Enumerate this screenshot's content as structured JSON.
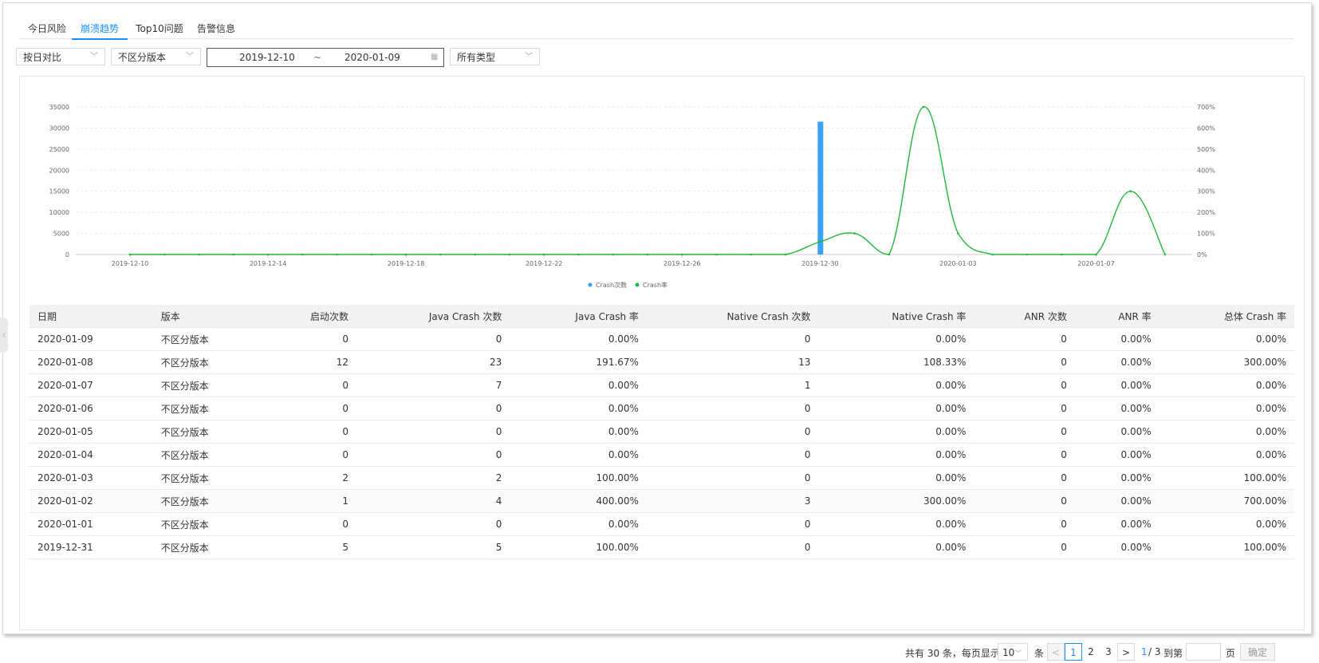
{
  "tabs": [
    {
      "label": "今日风险"
    },
    {
      "label": "崩溃趋势",
      "active": true
    },
    {
      "label": "Top10问题"
    },
    {
      "label": "告警信息"
    }
  ],
  "filters": {
    "compare": "按日对比",
    "version": "不区分版本",
    "date_start": "2019-12-10",
    "date_sep": "~",
    "date_end": "2020-01-09",
    "type": "所有类型"
  },
  "chart_data": {
    "type": "bar",
    "x": [
      "2019-12-10",
      "2019-12-11",
      "2019-12-12",
      "2019-12-13",
      "2019-12-14",
      "2019-12-15",
      "2019-12-16",
      "2019-12-17",
      "2019-12-18",
      "2019-12-19",
      "2019-12-20",
      "2019-12-21",
      "2019-12-22",
      "2019-12-23",
      "2019-12-24",
      "2019-12-25",
      "2019-12-26",
      "2019-12-27",
      "2019-12-28",
      "2019-12-29",
      "2019-12-30",
      "2019-12-31",
      "2020-01-01",
      "2020-01-02",
      "2020-01-03",
      "2020-01-04",
      "2020-01-05",
      "2020-01-06",
      "2020-01-07",
      "2020-01-08",
      "2020-01-09"
    ],
    "x_tick_labels": [
      "2019-12-10",
      "2019-12-14",
      "2019-12-18",
      "2019-12-22",
      "2019-12-26",
      "2019-12-30",
      "2020-01-03",
      "2020-01-07"
    ],
    "series": [
      {
        "name": "Crash次数",
        "type": "bar",
        "axis": "left",
        "color": "#3ba1f5",
        "values": [
          0,
          0,
          0,
          0,
          0,
          0,
          0,
          0,
          0,
          0,
          0,
          0,
          0,
          0,
          0,
          0,
          0,
          0,
          0,
          0,
          31500,
          0,
          0,
          0,
          0,
          0,
          0,
          0,
          0,
          0,
          0
        ]
      },
      {
        "name": "Crash率",
        "type": "line",
        "axis": "right",
        "color": "#20b83a",
        "values": [
          0,
          0,
          0,
          0,
          0,
          0,
          0,
          0,
          0,
          0,
          0,
          0,
          0,
          0,
          0,
          0,
          0,
          0,
          0,
          0,
          60,
          100,
          0,
          700,
          100,
          0,
          0,
          0,
          0,
          300,
          0
        ]
      }
    ],
    "y_left": {
      "ticks": [
        "0",
        "5000",
        "10000",
        "15000",
        "20000",
        "25000",
        "30000",
        "35000"
      ],
      "range": [
        0,
        35000
      ]
    },
    "y_right": {
      "ticks": [
        "0%",
        "100%",
        "200%",
        "300%",
        "400%",
        "500%",
        "600%",
        "700%"
      ],
      "range": [
        0,
        700
      ]
    },
    "legend": "bottom-center",
    "grid": true
  },
  "table": {
    "headers": [
      "日期",
      "版本",
      "启动次数",
      "Java Crash 次数",
      "Java Crash 率",
      "Native Crash 次数",
      "Native Crash 率",
      "ANR 次数",
      "ANR 率",
      "总体 Crash 率"
    ],
    "rows": [
      [
        "2020-01-09",
        "不区分版本",
        "0",
        "0",
        "0.00%",
        "0",
        "0.00%",
        "0",
        "0.00%",
        "0.00%"
      ],
      [
        "2020-01-08",
        "不区分版本",
        "12",
        "23",
        "191.67%",
        "13",
        "108.33%",
        "0",
        "0.00%",
        "300.00%"
      ],
      [
        "2020-01-07",
        "不区分版本",
        "0",
        "7",
        "0.00%",
        "1",
        "0.00%",
        "0",
        "0.00%",
        "0.00%"
      ],
      [
        "2020-01-06",
        "不区分版本",
        "0",
        "0",
        "0.00%",
        "0",
        "0.00%",
        "0",
        "0.00%",
        "0.00%"
      ],
      [
        "2020-01-05",
        "不区分版本",
        "0",
        "0",
        "0.00%",
        "0",
        "0.00%",
        "0",
        "0.00%",
        "0.00%"
      ],
      [
        "2020-01-04",
        "不区分版本",
        "0",
        "0",
        "0.00%",
        "0",
        "0.00%",
        "0",
        "0.00%",
        "0.00%"
      ],
      [
        "2020-01-03",
        "不区分版本",
        "2",
        "2",
        "100.00%",
        "0",
        "0.00%",
        "0",
        "0.00%",
        "100.00%"
      ],
      [
        "2020-01-02",
        "不区分版本",
        "1",
        "4",
        "400.00%",
        "3",
        "300.00%",
        "0",
        "0.00%",
        "700.00%"
      ],
      [
        "2020-01-01",
        "不区分版本",
        "0",
        "0",
        "0.00%",
        "0",
        "0.00%",
        "0",
        "0.00%",
        "0.00%"
      ],
      [
        "2019-12-31",
        "不区分版本",
        "5",
        "5",
        "100.00%",
        "0",
        "0.00%",
        "0",
        "0.00%",
        "100.00%"
      ]
    ],
    "highlight_row": 7
  },
  "pagination": {
    "total_text": "共有 30 条，每页显示",
    "page_size": "10",
    "unit": "条",
    "prev": "<",
    "pages": [
      "1",
      "2",
      "3"
    ],
    "current": "1",
    "next": ">",
    "current_of": "1",
    "total_pages": "/ 3",
    "goto_label": "到第",
    "page_unit": "页",
    "confirm": "确定"
  }
}
